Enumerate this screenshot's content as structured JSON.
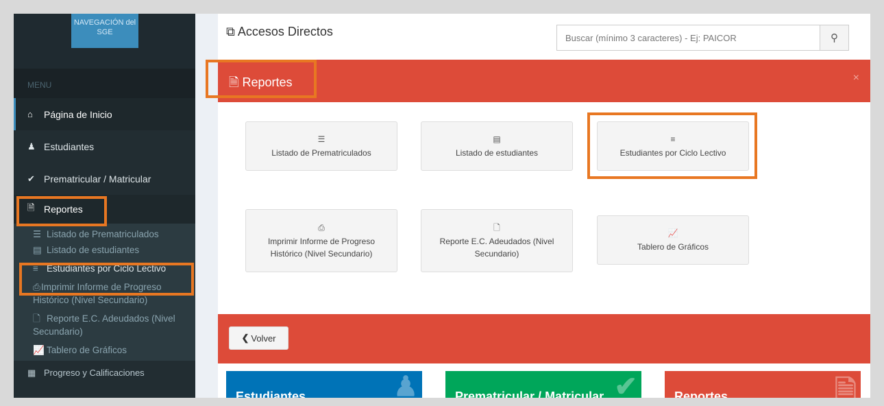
{
  "sidebar": {
    "nav_button": "NAVEGACIÓN del SGE",
    "menu_header": "MENU",
    "items": [
      {
        "label": "Página de Inicio",
        "icon": "home-icon"
      },
      {
        "label": "Estudiantes",
        "icon": "student-icon"
      },
      {
        "label": "Prematricular / Matricular",
        "icon": "check-icon"
      }
    ],
    "reportes": {
      "label": "Reportes",
      "icon": "file-text-icon"
    },
    "sub_items": [
      {
        "label": "Listado de Prematriculados",
        "icon": "list-icon"
      },
      {
        "label": "Listado de estudiantes",
        "icon": "list-alt-icon"
      },
      {
        "label": "Estudiantes por Ciclo Lectivo",
        "icon": "list-ol-icon"
      },
      {
        "label": "Imprimir Informe de Progreso Histórico (Nivel Secundario)",
        "icon": "print-icon"
      },
      {
        "label": "Reporte E.C. Adeudados (Nivel Secundario)",
        "icon": "file-icon"
      },
      {
        "label": "Tablero de Gráficos",
        "icon": "line-chart-icon"
      }
    ],
    "bottom_item": "Progreso y Calificaciones"
  },
  "main": {
    "title": "Accesos Directos",
    "search_placeholder": "Buscar (mínimo 3 caracteres) - Ej: PAICOR",
    "reportes_title": "Reportes",
    "close": "×",
    "tiles": [
      {
        "label": "Listado de Prematriculados",
        "icon": "list-icon"
      },
      {
        "label": "Listado de estudiantes",
        "icon": "list-alt-icon"
      },
      {
        "label": "Estudiantes por Ciclo Lectivo",
        "icon": "list-ol-icon"
      },
      {
        "label": "Imprimir Informe de Progreso Histórico (Nivel Secundario)",
        "icon": "print-icon"
      },
      {
        "label": "Reporte E.C. Adeudados (Nivel Secundario)",
        "icon": "file-icon"
      },
      {
        "label": "Tablero de Gráficos",
        "icon": "line-chart-icon"
      }
    ],
    "volver": "Volver",
    "boxes": [
      {
        "label": "Estudiantes",
        "color": "#0073b7"
      },
      {
        "label": "Prematricular / Matricular",
        "color": "#00a65a"
      },
      {
        "label": "Reportes",
        "color": "#dd4b39"
      }
    ]
  },
  "colors": {
    "highlight": "#e87722",
    "sidebar_bg": "#222d32",
    "header_red": "#dd4b39"
  }
}
